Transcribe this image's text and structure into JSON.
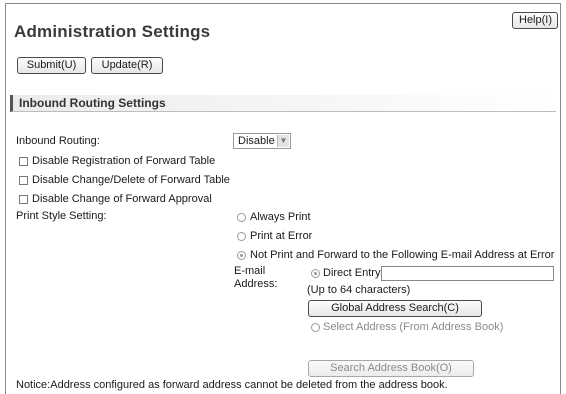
{
  "header": {
    "title": "Administration Settings",
    "help_label": "Help(I)",
    "submit_label": "Submit(U)",
    "update_label": "Update(R)"
  },
  "section": {
    "title": "Inbound Routing Settings"
  },
  "form": {
    "inbound_routing_label": "Inbound Routing:",
    "inbound_routing_value": "Disable",
    "checkboxes": [
      "Disable Registration of Forward Table",
      "Disable Change/Delete of Forward Table",
      "Disable Change of Forward Approval"
    ],
    "print_style_label": "Print Style Setting:",
    "print_options": [
      "Always Print",
      "Print at Error",
      "Not Print and Forward to the Following E-mail Address at Error"
    ],
    "email_label_line1": "E-mail",
    "email_label_line2": "Address:",
    "direct_entry_label": "Direct Entry:",
    "direct_entry_value": "",
    "char_limit_note": "(Up to 64 characters)",
    "global_search_label": "Global Address Search(C)",
    "select_address_label": "Select Address (From Address Book)",
    "search_book_label": "Search Address Book(O)"
  },
  "notice": "Notice:Address configured as forward address cannot be deleted from the address book."
}
